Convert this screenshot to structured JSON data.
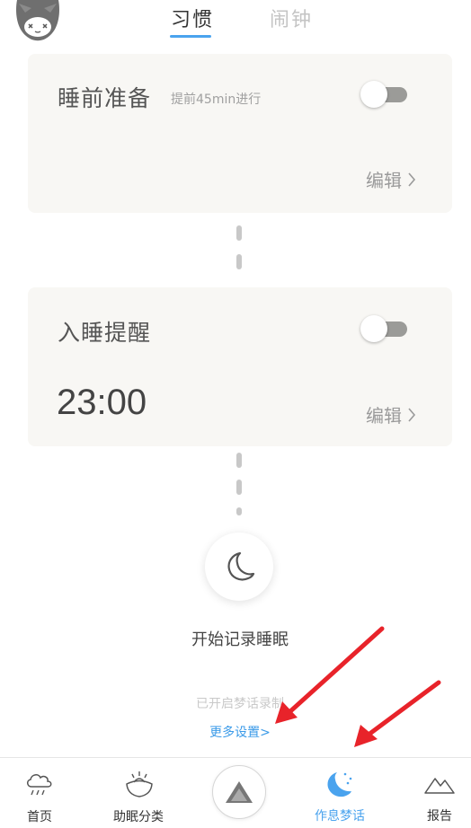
{
  "header": {
    "tabs": [
      {
        "label": "习惯",
        "active": true
      },
      {
        "label": "闹钟",
        "active": false
      }
    ]
  },
  "cards": [
    {
      "title": "睡前准备",
      "subtitle": "提前45min进行",
      "toggle_on": false,
      "edit_label": "编辑"
    },
    {
      "title": "入睡提醒",
      "time": "23:00",
      "toggle_on": false,
      "edit_label": "编辑"
    }
  ],
  "sleep": {
    "start_label": "开始记录睡眠",
    "sleeptalk_status": "已开启梦话录制",
    "more_settings": "更多设置>"
  },
  "bottom_nav": [
    {
      "label": "首页",
      "icon": "cloud-rain-icon",
      "active": false
    },
    {
      "label": "助眠分类",
      "icon": "bowl-icon",
      "active": false
    },
    {
      "label": "",
      "icon": "play-triangle-icon",
      "active": false
    },
    {
      "label": "作息梦话",
      "icon": "moon-stars-icon",
      "active": true
    },
    {
      "label": "报告",
      "icon": "mountain-icon",
      "active": false
    }
  ],
  "colors": {
    "accent": "#4aa3ee",
    "card_bg": "#f8f7f4",
    "arrow": "#e8232a"
  }
}
